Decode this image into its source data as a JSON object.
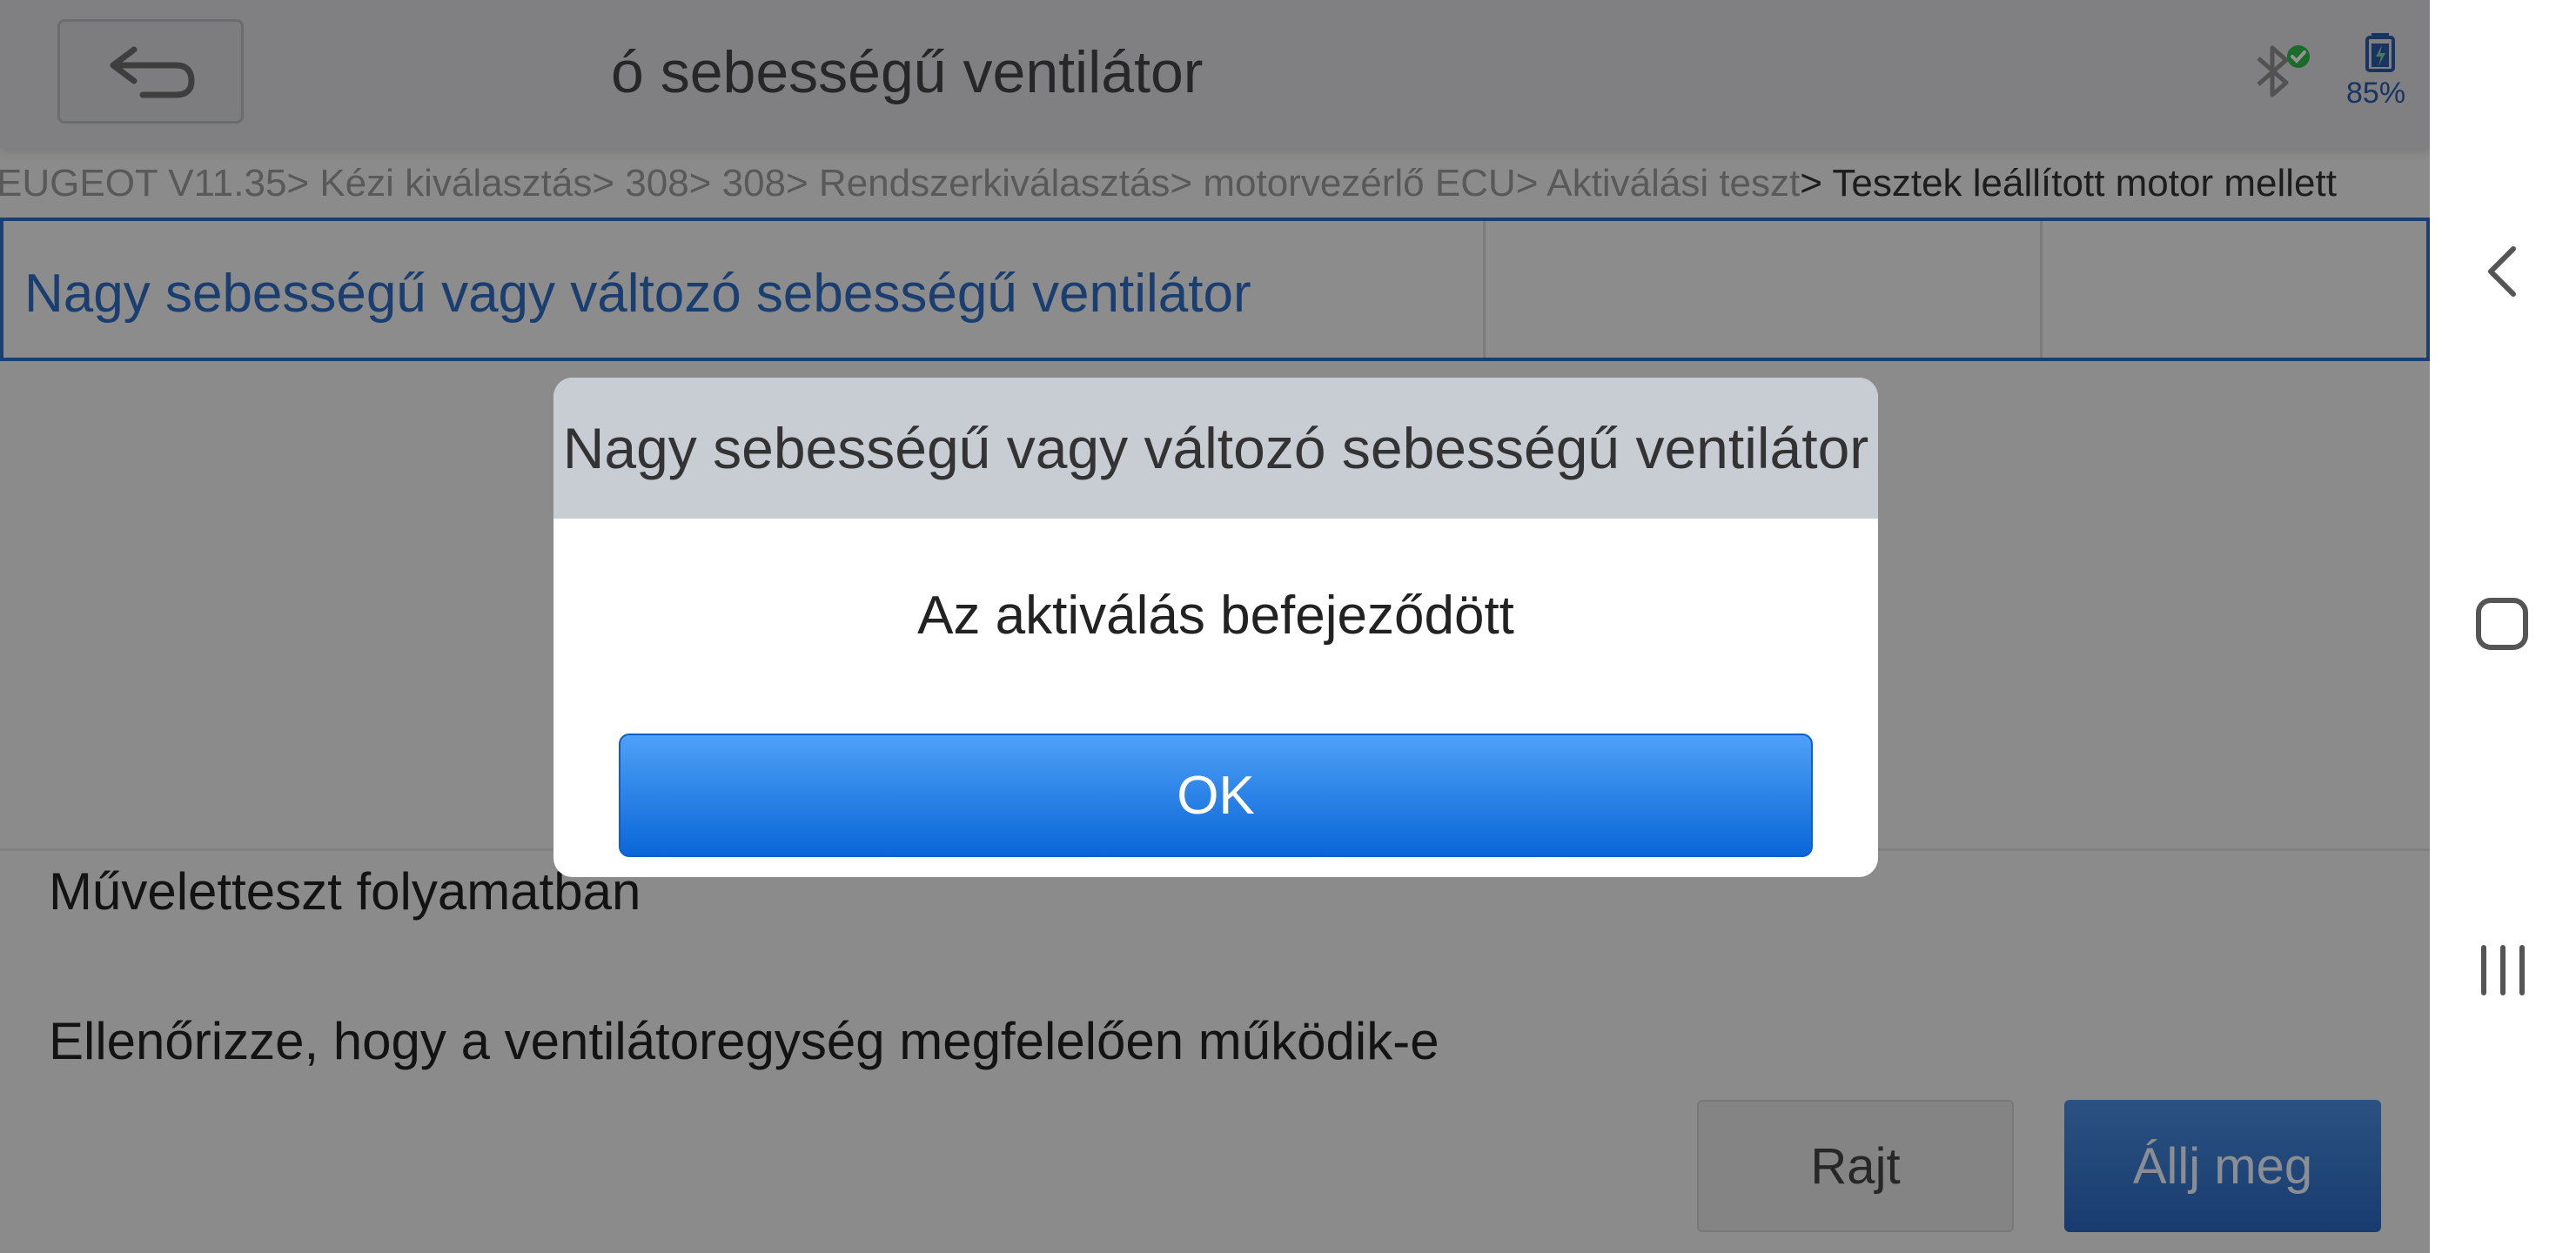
{
  "header": {
    "title_visible": "ó sebességű ventilátor",
    "battery_percent": "85%",
    "icons": [
      "back-arrow-icon",
      "bluetooth-connected-icon",
      "battery-icon"
    ]
  },
  "breadcrumb": {
    "path": "EUGEOT V11.35> Kézi kiválasztás> 308> 308> Rendszerkiválasztás> motorvezérlő ECU> Aktiválási teszt",
    "current": "> Tesztek leállított motor mellett"
  },
  "selected_row": {
    "label": "Nagy sebességű vagy változó sebességű ventilátor"
  },
  "status": {
    "line1": "Műveletteszt folyamatban",
    "line2": "Ellenőrizze, hogy a ventilátoregység megfelelően működik-e"
  },
  "buttons": {
    "start": "Rajt",
    "stop": "Állj meg"
  },
  "dialog": {
    "title": "Nagy sebességű vagy változó sebességű ventilátor",
    "message": "Az aktiválás befejeződött",
    "ok": "OK"
  },
  "system_nav": {
    "icons": [
      "nav-back-icon",
      "nav-home-icon",
      "nav-recent-apps-icon"
    ]
  },
  "colors": {
    "accent": "#2d6cc0",
    "ok_button": "#0a66d8",
    "bluetooth_ok": "#2fb84a"
  }
}
